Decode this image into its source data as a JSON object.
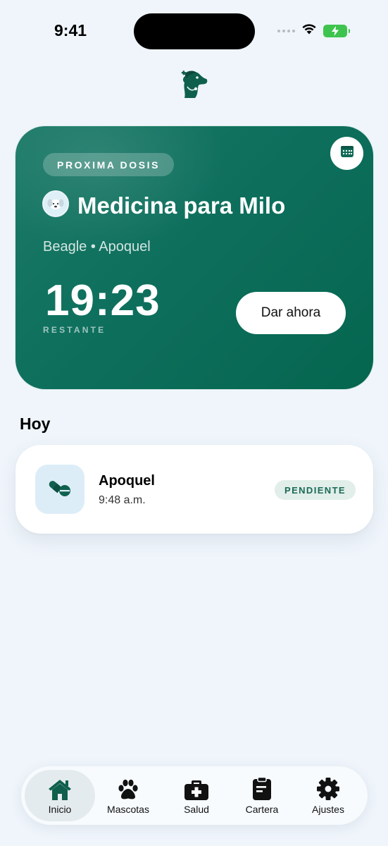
{
  "status_bar": {
    "time": "9:41"
  },
  "colors": {
    "brand": "#0e6f5d",
    "background": "#eff5fb",
    "battery": "#3ec44e"
  },
  "hero": {
    "badge": "PROXIMA DOSIS",
    "title": "Medicina para Milo",
    "subtitle": "Beagle • Apoquel",
    "countdown": "19:23",
    "remaining_label": "RESTANTE",
    "action_label": "Dar ahora",
    "calendar_icon": "calendar-icon"
  },
  "today": {
    "title": "Hoy",
    "items": [
      {
        "name": "Apoquel",
        "time": "9:48 a.m.",
        "status": "PENDIENTE",
        "icon": "pills-icon"
      }
    ]
  },
  "tabbar": {
    "items": [
      {
        "label": "Inicio",
        "icon": "home-icon",
        "active": true
      },
      {
        "label": "Mascotas",
        "icon": "paw-icon",
        "active": false
      },
      {
        "label": "Salud",
        "icon": "medkit-icon",
        "active": false
      },
      {
        "label": "Cartera",
        "icon": "clipboard-icon",
        "active": false
      },
      {
        "label": "Ajustes",
        "icon": "gear-icon",
        "active": false
      }
    ]
  }
}
